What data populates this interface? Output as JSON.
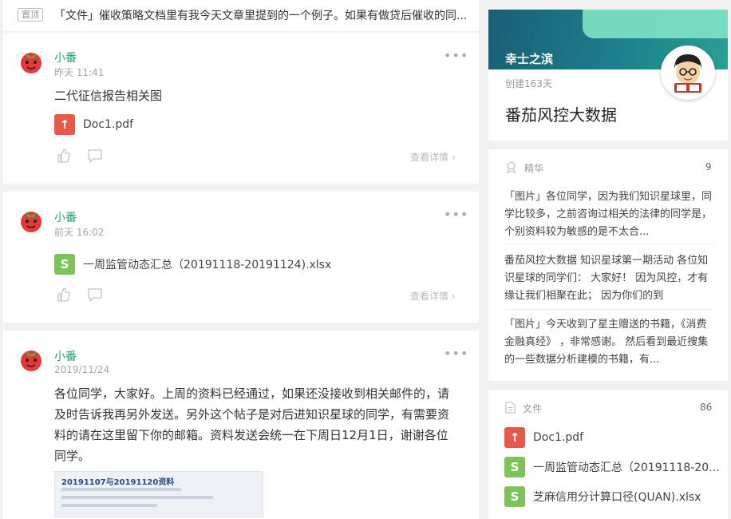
{
  "pinned": {
    "badge": "置顶",
    "text": "「文件」催收策略文档里有我今天文章里提到的一个例子。如果有做贷后催收的同..."
  },
  "posts": [
    {
      "author": "小番",
      "time": "昨天 11:41",
      "text": "二代征信报告相关图",
      "file": {
        "name": "Doc1.pdf",
        "type": "pdf"
      },
      "detail_label": "查看详情"
    },
    {
      "author": "小番",
      "time": "前天 16:02",
      "text": "",
      "file": {
        "name": "一周监管动态汇总（20191118-20191124).xlsx",
        "type": "xlsx"
      },
      "detail_label": "查看详情"
    },
    {
      "author": "小番",
      "time": "2019/11/24",
      "text": "各位同学，大家好。上周的资料已经通过，如果还没接收到相关邮件的，请及时告诉我再另外发送。另外这个帖子是对后进知识星球的同学，有需要资料的请在这里留下你的邮箱。资料发送会统一在下周日12月1日，谢谢各位同学。",
      "image_title": "20191107与20191120资料"
    }
  ],
  "sidebar": {
    "planet_name": "幸士之滨",
    "created": "创建163天",
    "title": "番茄风控大数据",
    "essence": {
      "label": "精华",
      "count": "9",
      "items": [
        "「图片」各位同学，因为我们知识星球里，同学比较多，之前咨询过相关的法律的同学是，个别资料较为敏感的是不太合...",
        "番茄风控大数据 知识星球第一期活动 各位知识星球的同学们： 大家好！ 因为风控，才有缘让我们相聚在此； 因为你们的到",
        "「图片」今天收到了星主赠送的书籍，《消费金融真经》 ，非常感谢。 然后看到最近搜集的一些数据分析建模的书籍，有..."
      ]
    },
    "files": {
      "label": "文件",
      "count": "86",
      "items": [
        {
          "name": "Doc1.pdf",
          "type": "pdf"
        },
        {
          "name": "一周监管动态汇总（20191118-20...",
          "type": "xlsx"
        },
        {
          "name": "芝麻信用分计算口径(QUAN).xlsx",
          "type": "xlsx"
        }
      ]
    }
  },
  "colors": {
    "author": "#1aa56e",
    "pdf": "#e8584a",
    "xlsx": "#7cc45a",
    "banner": "#1d7f8c"
  }
}
